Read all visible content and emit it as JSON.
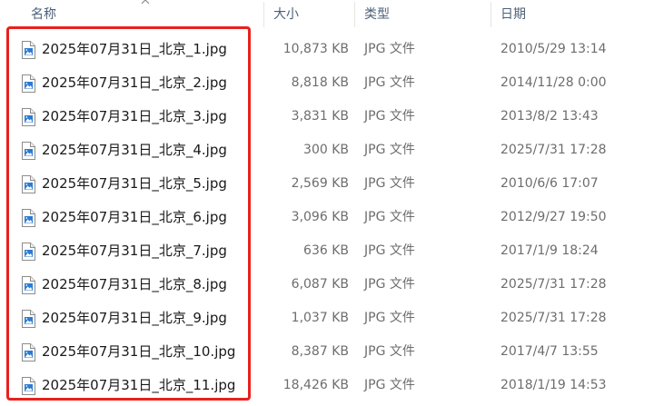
{
  "header": {
    "name_label": "名称",
    "size_label": "大小",
    "type_label": "类型",
    "date_label": "日期"
  },
  "accent_colors": {
    "highlight_border": "#e8211d",
    "header_text": "#4c607a",
    "file_icon_blue": "#2b7cd3"
  },
  "files": [
    {
      "name": "2025年07月31日_北京_1.jpg",
      "size": "10,873 KB",
      "type": "JPG 文件",
      "date": "2010/5/29 13:14",
      "icon": "jpg-file-icon"
    },
    {
      "name": "2025年07月31日_北京_2.jpg",
      "size": "8,818 KB",
      "type": "JPG 文件",
      "date": "2014/11/28 0:00",
      "icon": "jpg-file-icon"
    },
    {
      "name": "2025年07月31日_北京_3.jpg",
      "size": "3,831 KB",
      "type": "JPG 文件",
      "date": "2013/8/2 13:43",
      "icon": "jpg-file-icon"
    },
    {
      "name": "2025年07月31日_北京_4.jpg",
      "size": "300 KB",
      "type": "JPG 文件",
      "date": "2025/7/31 17:28",
      "icon": "jpg-file-icon"
    },
    {
      "name": "2025年07月31日_北京_5.jpg",
      "size": "2,569 KB",
      "type": "JPG 文件",
      "date": "2010/6/6 17:07",
      "icon": "jpg-file-icon"
    },
    {
      "name": "2025年07月31日_北京_6.jpg",
      "size": "3,096 KB",
      "type": "JPG 文件",
      "date": "2012/9/27 19:50",
      "icon": "jpg-file-icon"
    },
    {
      "name": "2025年07月31日_北京_7.jpg",
      "size": "636 KB",
      "type": "JPG 文件",
      "date": "2017/1/9 18:24",
      "icon": "jpg-file-icon"
    },
    {
      "name": "2025年07月31日_北京_8.jpg",
      "size": "6,087 KB",
      "type": "JPG 文件",
      "date": "2025/7/31 17:28",
      "icon": "jpg-file-icon"
    },
    {
      "name": "2025年07月31日_北京_9.jpg",
      "size": "1,037 KB",
      "type": "JPG 文件",
      "date": "2025/7/31 17:28",
      "icon": "jpg-file-icon"
    },
    {
      "name": "2025年07月31日_北京_10.jpg",
      "size": "8,387 KB",
      "type": "JPG 文件",
      "date": "2017/4/7 13:55",
      "icon": "jpg-file-icon"
    },
    {
      "name": "2025年07月31日_北京_11.jpg",
      "size": "18,426 KB",
      "type": "JPG 文件",
      "date": "2018/1/19 14:53",
      "icon": "jpg-file-icon"
    }
  ]
}
